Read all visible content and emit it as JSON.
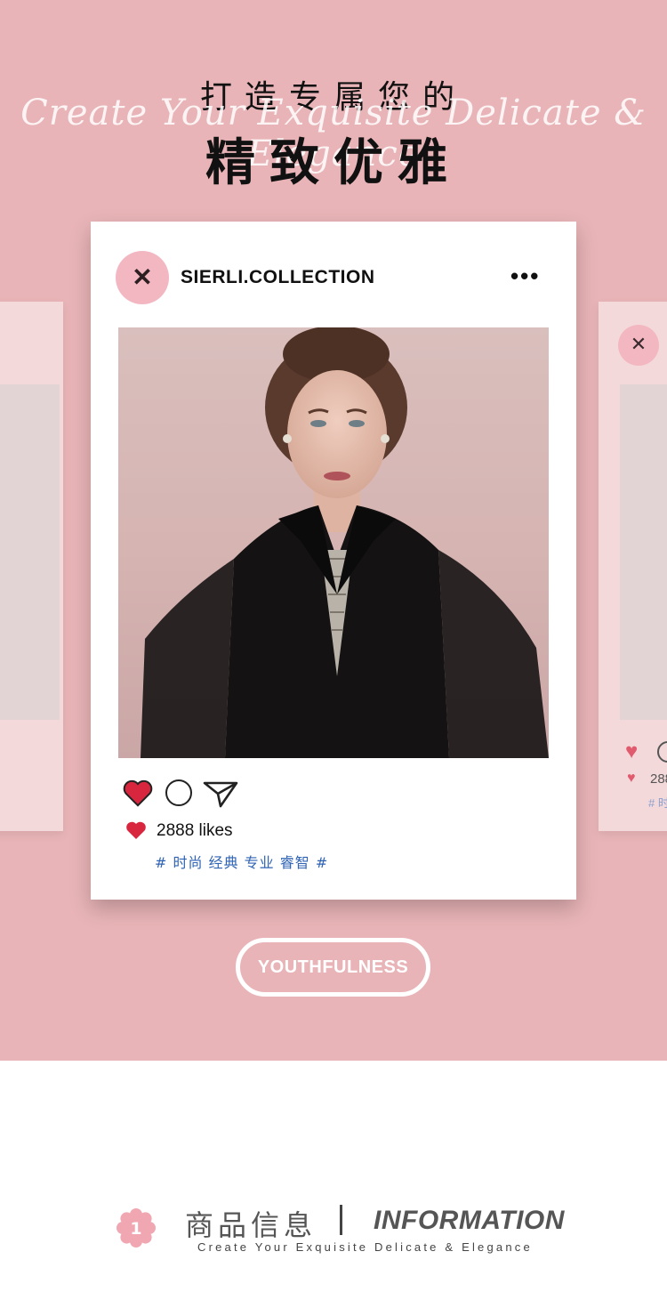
{
  "header": {
    "title_top": "打造专属您的",
    "title_script": "Create Your Exquisite Delicate & Elegance",
    "title_main": "精致优雅"
  },
  "post": {
    "avatar_glyph": "✕",
    "username": "SIERLI.COLLECTION",
    "more_icon": "•••",
    "likes": "2888 likes",
    "tags": "# 时尚 经典 专业 睿智 #"
  },
  "ghost_right": {
    "likes": "288",
    "tag": "# 时"
  },
  "button": {
    "label": "YOUTHFULNESS"
  },
  "info": {
    "number": "1",
    "title_cn": "商品信息",
    "title_en": "INFORMATION",
    "subtitle": "Create Your Exquisite Delicate & Elegance"
  },
  "colors": {
    "hero_bg": "#e8b4b7",
    "heart": "#d8263f",
    "tag_blue": "#2f63b4",
    "avatar_pink": "#f3b7c1"
  }
}
